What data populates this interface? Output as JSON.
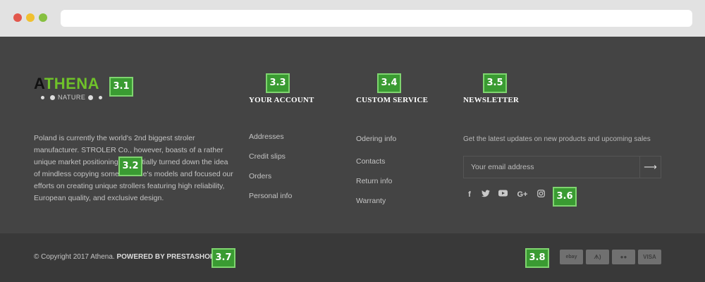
{
  "logo": {
    "first_letter": "A",
    "rest": "THENA",
    "sub": "NATURE"
  },
  "about": {
    "text": "Poland is currently the world's 2nd biggest stroler manufacturer. STROLER Co., however, boasts of a rather unique market positioning and initially turned down the idea of mindless copying someone else's models and focused our efforts on creating unique strollers featuring high reliability, European quality, and exclusive design."
  },
  "your_account": {
    "title": "YOUR ACCOUNT",
    "links": [
      "Addresses",
      "Credit slips",
      "Orders",
      "Personal info"
    ]
  },
  "custom_service": {
    "title": "CUSTOM SERVICE",
    "links": [
      "Odering info",
      "Contacts",
      "Return info",
      "Warranty"
    ]
  },
  "newsletter": {
    "title": "NEWSLETTER",
    "description": "Get the latest updates on new products and upcoming sales",
    "email_placeholder": "Your email address",
    "submit_icon": "arrow-right-icon"
  },
  "social": [
    {
      "name": "facebook-icon",
      "glyph": "f"
    },
    {
      "name": "twitter-icon",
      "glyph": "🐦"
    },
    {
      "name": "youtube-icon",
      "glyph": "▶"
    },
    {
      "name": "google-plus-icon",
      "glyph": "G+"
    },
    {
      "name": "instagram-icon",
      "glyph": "◎"
    }
  ],
  "copyright": {
    "text": "© Copyright 2017 Athena.",
    "powered": "POWERED BY PRESTASHOP"
  },
  "payments": [
    "ebay",
    "ᗑ)",
    "●●",
    "VISA"
  ],
  "annotation_tags": [
    "3.1",
    "3.2",
    "3.3",
    "3.4",
    "3.5",
    "3.6",
    "3.7",
    "3.8"
  ],
  "colors": {
    "footer_bg": "#444444",
    "bottom_bg": "#393939",
    "brand_green": "#6fc12a",
    "tag_green": "#3a9b32"
  }
}
